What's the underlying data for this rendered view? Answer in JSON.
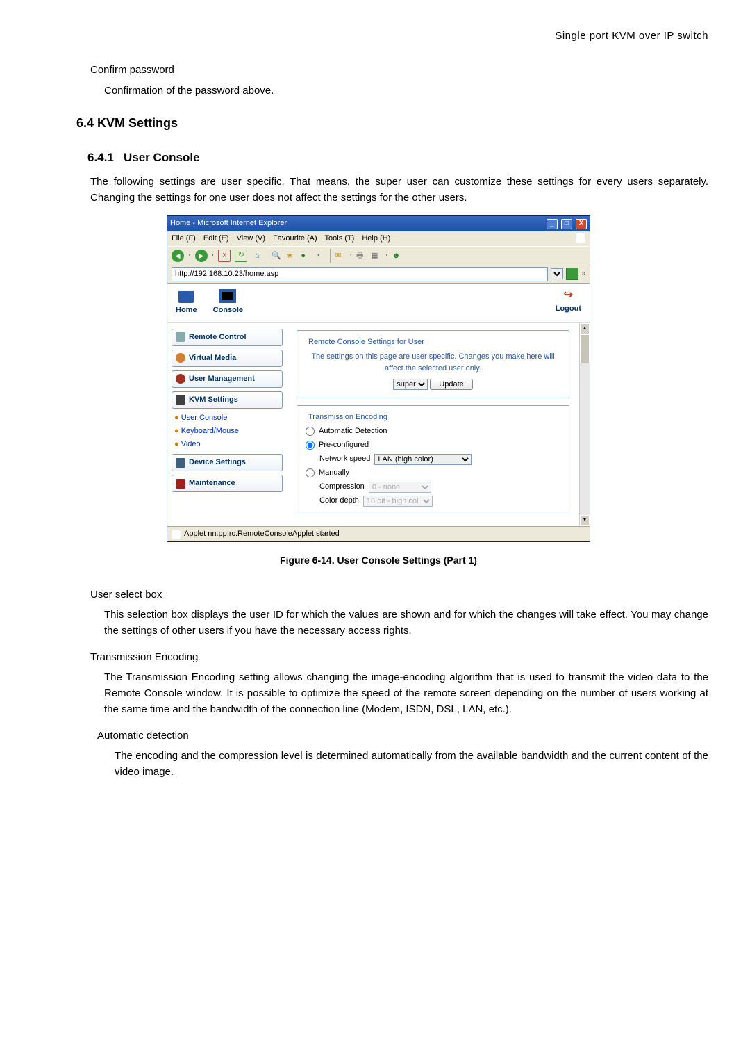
{
  "header_right": "Single port KVM over IP switch",
  "sec_confirm_pw": {
    "title": "Confirm password",
    "body": "Confirmation of the password above."
  },
  "sec_64": {
    "num": "6.4",
    "title": "KVM Settings"
  },
  "sec_641": {
    "num": "6.4.1",
    "title": "User Console",
    "intro": "The following settings are user specific. That means, the super user can customize these settings for every users separately. Changing the settings for one user does not affect the settings for the other users."
  },
  "browser": {
    "title": "Home - Microsoft Internet Explorer",
    "menu": {
      "file": "File (F)",
      "edit": "Edit (E)",
      "view": "View (V)",
      "favorites": "Favourite (A)",
      "tools": "Tools (T)",
      "help": "Help (H)"
    },
    "address_label": "",
    "url": "http://192.168.10.23/home.asp",
    "status": "Applet nn.pp.rc.RemoteConsoleApplet started"
  },
  "app": {
    "tabs": {
      "home": "Home",
      "console": "Console",
      "logout": "Logout"
    },
    "sidebar": {
      "remote_control": "Remote Control",
      "virtual_media": "Virtual Media",
      "user_mgmt": "User Management",
      "kvm_settings": "KVM Settings",
      "sub_user_console": "User Console",
      "sub_keyboard": "Keyboard/Mouse",
      "sub_video": "Video",
      "device_settings": "Device Settings",
      "maintenance": "Maintenance"
    },
    "panel1": {
      "legend": "Remote Console Settings for User",
      "note": "The settings on this page are user specific. Changes you make here will affect the selected user only.",
      "select_value": "super",
      "update_btn": "Update"
    },
    "panel2": {
      "legend": "Transmission Encoding",
      "opt_auto": "Automatic Detection",
      "opt_pre": "Pre-configured",
      "net_label": "Network speed",
      "net_value": "LAN (high color)",
      "opt_manual": "Manually",
      "comp_label": "Compression",
      "comp_value": "0 - none",
      "depth_label": "Color depth",
      "depth_value": "16 bit - high col"
    }
  },
  "fig_caption": "Figure 6-14. User Console Settings (Part 1)",
  "sec_user_select": {
    "title": "User select box",
    "body": "This selection box displays the user ID for which the values are shown and for which the changes will take effect. You may change the settings of other users if you have the necessary access rights."
  },
  "sec_trans_enc": {
    "title": "Transmission Encoding",
    "body": "The Transmission Encoding setting allows changing the image-encoding algorithm that is used to transmit the video data to the Remote Console window. It is possible to optimize the speed of the remote screen depending on the number of users working at the same time and the bandwidth of the connection line (Modem, ISDN, DSL, LAN, etc.)."
  },
  "sec_auto_detect": {
    "title": "Automatic detection",
    "body": "The encoding and the compression level is determined automatically from the available bandwidth and the current content of the video image."
  }
}
